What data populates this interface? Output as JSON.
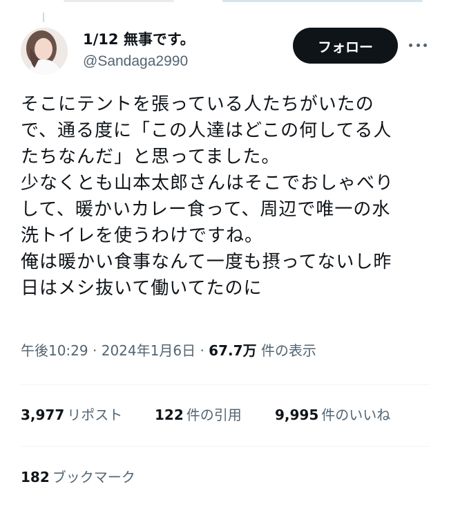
{
  "author": {
    "display_name": "1/12 無事です。",
    "handle": "@Sandaga2990"
  },
  "follow_button": {
    "label": "フォロー"
  },
  "tweet": {
    "lines": [
      "そこにテントを張っている人たちがいたの",
      "で、通る度に「この人達はどこの何してる人",
      "たちなんだ」と思ってました。",
      "少なくとも山本太郎さんはそこでおしゃべり",
      "して、暖かいカレー食って、周辺で唯一の水",
      "洗トイレを使うわけですね。",
      "俺は暖かい食事なんて一度も摂ってないし昨",
      "日はメシ抜いて働いてたのに"
    ]
  },
  "meta": {
    "time": "午後10:29",
    "separator": "·",
    "date": "2024年1月6日",
    "views_count": "67.7万",
    "views_label": "件の表示"
  },
  "stats": {
    "reposts_count": "3,977",
    "reposts_label": "リポスト",
    "quotes_count": "122",
    "quotes_label": "件の引用",
    "likes_count": "9,995",
    "likes_label": "件のいいね"
  },
  "bookmarks": {
    "count": "182",
    "label": "ブックマーク"
  },
  "colors": {
    "text": "#0f1419",
    "secondary": "#536471",
    "follow_bg": "#0f1419",
    "divider": "#eff3f4"
  }
}
